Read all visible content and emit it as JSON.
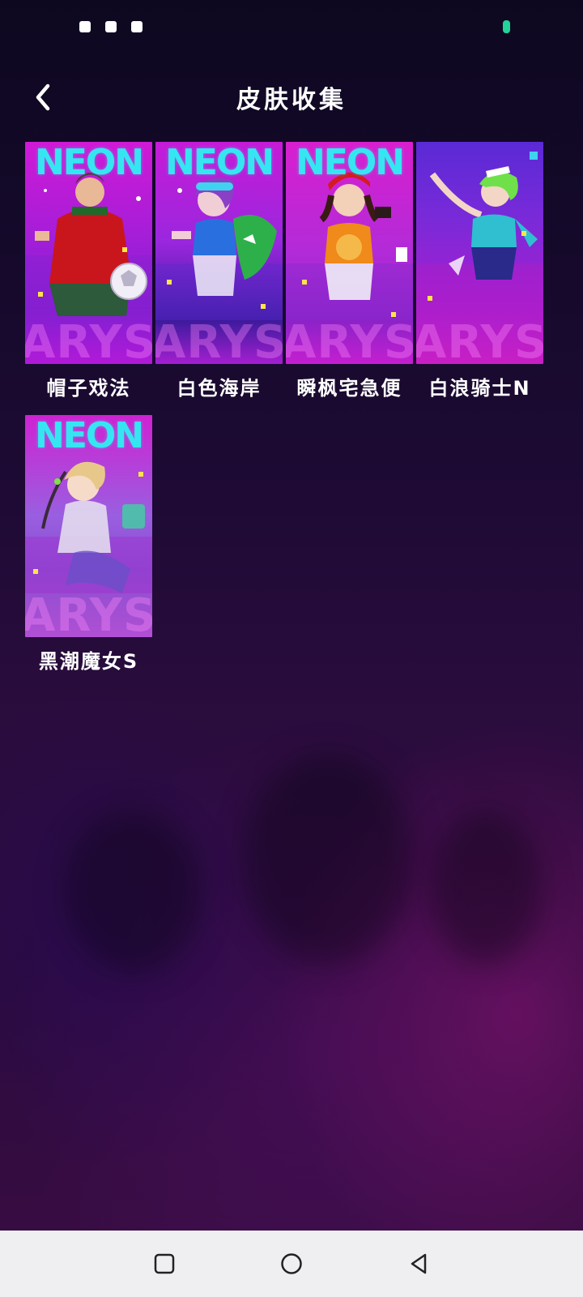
{
  "status_bar": {
    "time": "",
    "battery_color": "#22d39a"
  },
  "header": {
    "title": "皮肤收集",
    "back_icon": "chevron-left-icon"
  },
  "skins": [
    {
      "name": "帽子戏法",
      "logo": "NEON",
      "watermark": "ARYSO",
      "colors": [
        "#d01ad6",
        "#7f1fd1",
        "#2a1a8a"
      ]
    },
    {
      "name": "白色海岸",
      "logo": "NEON",
      "watermark": "ARYSO",
      "colors": [
        "#c61bd7",
        "#8a2be0",
        "#3b1a9c"
      ]
    },
    {
      "name": "瞬枫宅急便",
      "logo": "NEON",
      "watermark": "ARYSO",
      "colors": [
        "#d81fcf",
        "#a62bd8",
        "#5a1aa0"
      ]
    },
    {
      "name": "白浪骑士N",
      "logo": "",
      "watermark": "ARYSO",
      "colors": [
        "#5a2ad6",
        "#a41fd0",
        "#c81fc4"
      ]
    },
    {
      "name": "黑潮魔女S",
      "logo": "NEON",
      "watermark": "ARYSO",
      "colors": [
        "#cf22d2",
        "#9a5ee0",
        "#b04fd4"
      ]
    }
  ],
  "nav_bar": {
    "recent_icon": "square-icon",
    "home_icon": "circle-icon",
    "back_icon": "triangle-back-icon"
  }
}
